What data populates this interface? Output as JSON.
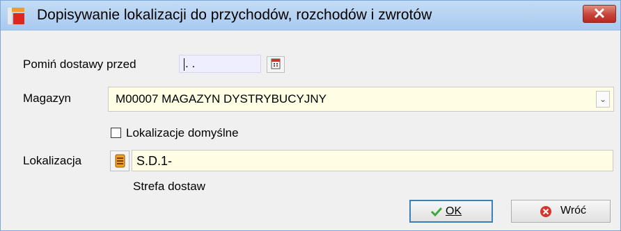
{
  "window": {
    "title": "Dopisywanie lokalizacji do przychodów, rozchodów i zwrotów",
    "close_label": "✕"
  },
  "form": {
    "skip_deliveries_label": "Pomiń dostawy przed",
    "skip_deliveries_value": " . .",
    "warehouse_label": "Magazyn",
    "warehouse_value": "M00007 MAGAZYN DYSTRYBUCYJNY",
    "default_locations_label": "Lokalizacje domyślne",
    "default_locations_checked": false,
    "location_label": "Lokalizacja",
    "location_value": "S.D.1-",
    "location_description": "Strefa dostaw"
  },
  "buttons": {
    "ok_label": "OK",
    "back_label": "Wróć"
  },
  "icons": {
    "app": "app-icon",
    "calendar": "calendar-icon",
    "location_picker": "location-picker-icon",
    "ok": "checkmark-icon",
    "back": "cancel-icon"
  },
  "colors": {
    "title_gradient_top": "#c4dcf4",
    "close_red": "#c7433a",
    "field_yellow": "#fffde3",
    "field_lavender": "#eeeeff",
    "ok_border": "#3c7fb1"
  }
}
